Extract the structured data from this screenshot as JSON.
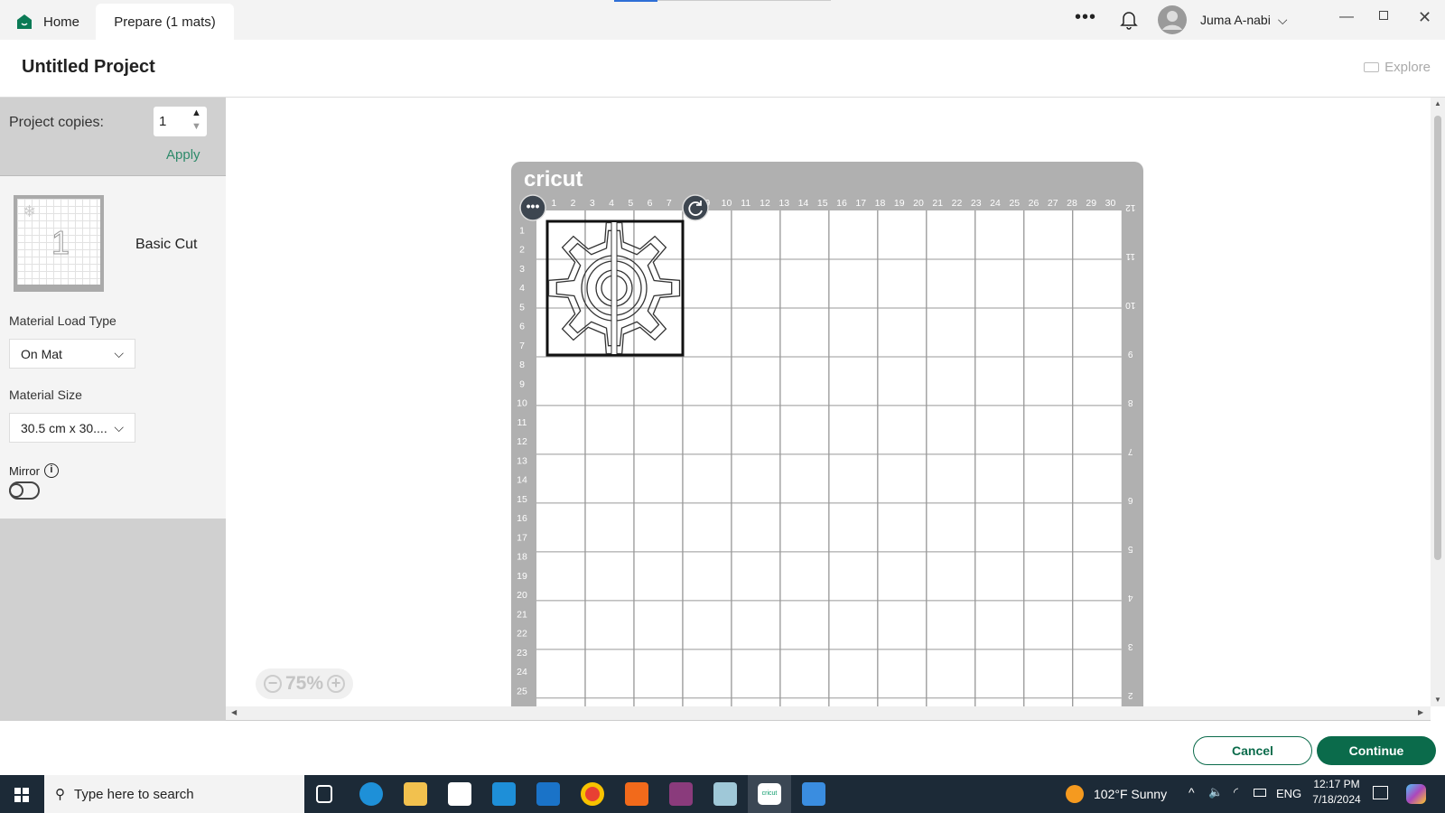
{
  "tabs": [
    {
      "label": "Home",
      "icon": "home-icon"
    },
    {
      "label": "Prepare (1 mats)"
    }
  ],
  "user": {
    "name": "Juma A-nabi"
  },
  "header": {
    "title": "Untitled Project",
    "explore": "Explore"
  },
  "sidebar": {
    "copies_label": "Project copies:",
    "copies_value": "1",
    "apply": "Apply",
    "mat_number": "1",
    "mat_label": "Basic Cut",
    "load_type_label": "Material Load Type",
    "load_type_value": "On Mat",
    "size_label": "Material Size",
    "size_value": "30.5 cm x 30....",
    "mirror_label": "Mirror",
    "mirror_on": false
  },
  "mat": {
    "brand": "cricut",
    "cm_ticks": 30,
    "row_ticks": 25,
    "inch_ticks": [
      12,
      11,
      10,
      9,
      8,
      7,
      6,
      5,
      4,
      3,
      2
    ]
  },
  "zoom": {
    "level": "75%"
  },
  "footer": {
    "cancel": "Cancel",
    "continue": "Continue"
  },
  "colors": {
    "accent": "#0b6b4b",
    "mat": "#b0b0b0"
  },
  "taskbar": {
    "search_placeholder": "Type here to search",
    "weather": "102°F  Sunny",
    "lang": "ENG",
    "time": "12:17 PM",
    "date": "7/18/2024"
  }
}
